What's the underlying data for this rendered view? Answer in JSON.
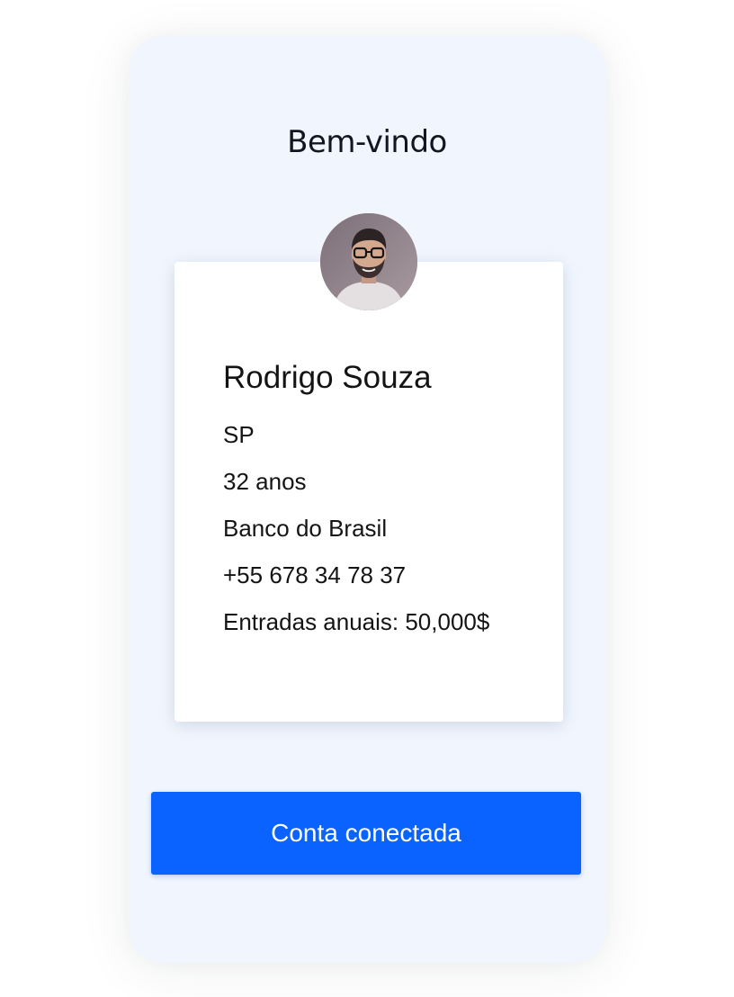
{
  "header": {
    "title": "Bem-vindo"
  },
  "profile": {
    "avatar_icon": "user-photo",
    "name": "Rodrigo Souza",
    "state": "SP",
    "age": "32 anos",
    "bank": "Banco do Brasil",
    "phone": "+55 678 34 78 37",
    "annual_income": "Entradas anuais: 50,000$"
  },
  "action": {
    "button_label": "Conta conectada"
  },
  "colors": {
    "background": "#ffffff",
    "device": "#f1f6fe",
    "card": "#ffffff",
    "accent": "#0a62ff",
    "text": "#141414"
  }
}
